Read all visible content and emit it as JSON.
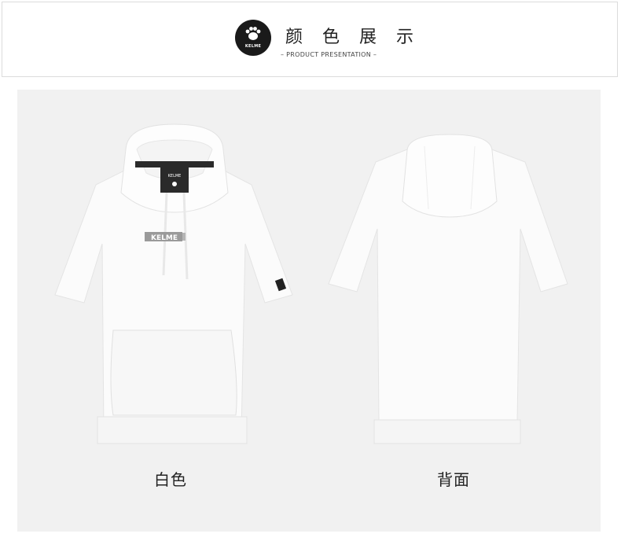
{
  "header": {
    "logo_text": "KELME",
    "title": "颜 色 展 示",
    "subtitle": "– PRODUCT PRESENTATION –"
  },
  "products": [
    {
      "caption": "白色",
      "view": "front",
      "chest_print": "KELME",
      "tag_text": "KELME"
    },
    {
      "caption": "背面",
      "view": "back"
    }
  ],
  "colors": {
    "garment": "#fafafa",
    "panel": "#f1f1f1"
  }
}
